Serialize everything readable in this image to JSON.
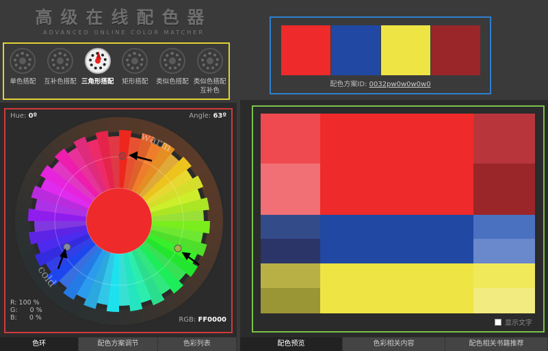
{
  "title": {
    "cn": "高级在线配色器",
    "en": "ADVANCED ONLINE COLOR MATCHER"
  },
  "modes": [
    {
      "label": "单色搭配",
      "icon": "mono-wheel-icon",
      "active": false
    },
    {
      "label": "互补色搭配",
      "icon": "complement-wheel-icon",
      "active": false
    },
    {
      "label": "三角形搭配",
      "icon": "triad-wheel-icon",
      "active": true
    },
    {
      "label": "矩形搭配",
      "icon": "tetrad-wheel-icon",
      "active": false
    },
    {
      "label": "类似色搭配",
      "icon": "analogous-wheel-icon",
      "active": false
    },
    {
      "label": "类似色搭配互补色",
      "icon": "analogous-complement-wheel-icon",
      "active": false
    }
  ],
  "scheme": {
    "colors": [
      "#ee2a2a",
      "#2148a3",
      "#eee444",
      "#9a262a"
    ],
    "id_label": "配色方案ID:",
    "id_value": "0032pw0w0w0w0"
  },
  "wheel": {
    "hue_label": "Hue:",
    "hue_value": "0º",
    "angle_label": "Angle:",
    "angle_value": "63º",
    "warm_label": "warm",
    "cold_label": "cold",
    "rgb_values": "R: 100 %\nG:      0 %\nB:      0 %",
    "hex_label": "RGB:",
    "hex_value": "FF0000",
    "center_color": "#ee2a2a"
  },
  "left_tabs": [
    "色环",
    "配色方案调节",
    "色彩列表"
  ],
  "right_tabs": [
    "配色预览",
    "色彩相关内容",
    "配色相关书籍推荐"
  ],
  "preview": {
    "show_text_label": "显示文字",
    "colors": {
      "red_main": "#ee2a2a",
      "red_l1": "#ee4a4f",
      "red_l2": "#f07075",
      "red_r1": "#b8363b",
      "red_r2": "#9a262a",
      "blue_main": "#2148a3",
      "blue_l1": "#344b8a",
      "blue_l2": "#2c3568",
      "blue_r1": "#4a70c0",
      "blue_r2": "#6a88cc",
      "yellow_main": "#eee444",
      "yellow_l1": "#b8b045",
      "yellow_l2": "#9a9535",
      "yellow_r1": "#f0ea5a",
      "yellow_r2": "#f2ec80"
    }
  }
}
